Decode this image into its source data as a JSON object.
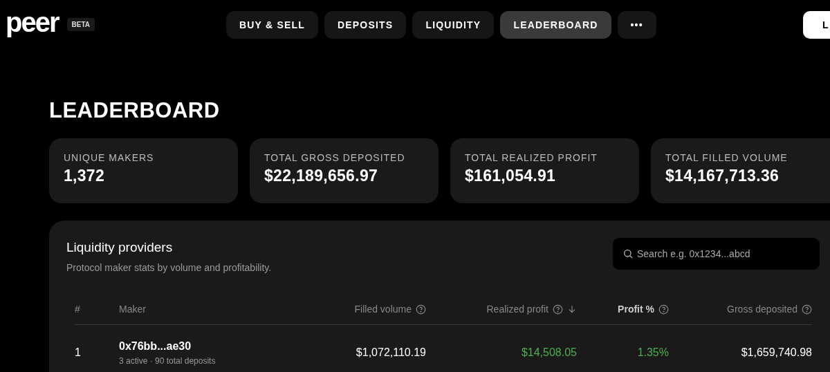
{
  "header": {
    "logo": "peer",
    "badge": "BETA",
    "nav": [
      {
        "label": "BUY & SELL",
        "selected": false
      },
      {
        "label": "DEPOSITS",
        "selected": false
      },
      {
        "label": "LIQUIDITY",
        "selected": false
      },
      {
        "label": "LEADERBOARD",
        "selected": true
      },
      {
        "label": "•••",
        "selected": false
      }
    ],
    "action_button": "L"
  },
  "page_title": "LEADERBOARD",
  "stats": [
    {
      "label": "UNIQUE MAKERS",
      "value": "1,372"
    },
    {
      "label": "TOTAL GROSS DEPOSITED",
      "value": "$22,189,656.97"
    },
    {
      "label": "TOTAL REALIZED PROFIT",
      "value": "$161,054.91"
    },
    {
      "label": "TOTAL FILLED VOLUME",
      "value": "$14,167,713.36"
    }
  ],
  "table": {
    "title": "Liquidity providers",
    "subtitle": "Protocol maker stats by volume and profitability.",
    "search": {
      "placeholder": "Search e.g. 0x1234...abcd"
    },
    "columns": [
      {
        "label": "#",
        "info": false,
        "sorted": false,
        "emphasized": false
      },
      {
        "label": "Maker",
        "info": false,
        "sorted": false,
        "emphasized": false
      },
      {
        "label": "Filled volume",
        "info": true,
        "sorted": false,
        "emphasized": false
      },
      {
        "label": "Realized profit",
        "info": true,
        "sorted": true,
        "emphasized": false
      },
      {
        "label": "Profit %",
        "info": true,
        "sorted": false,
        "emphasized": true
      },
      {
        "label": "Gross deposited",
        "info": true,
        "sorted": false,
        "emphasized": false
      }
    ],
    "rows": [
      {
        "rank": "1",
        "maker": "0x76bb...ae30",
        "detail": "3 active · 90 total deposits",
        "filled_volume": "$1,072,110.19",
        "realized_profit": "$14,508.05",
        "profit_pct": "1.35%",
        "gross_deposited": "$1,659,740.98"
      }
    ]
  }
}
